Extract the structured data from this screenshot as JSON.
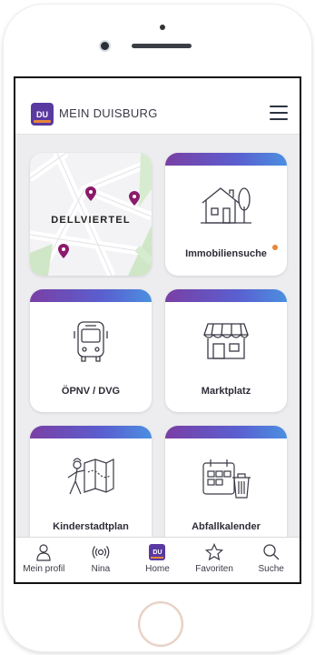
{
  "header": {
    "logo_text": "DU",
    "title": "MEIN DUISBURG"
  },
  "tiles": {
    "map": {
      "label": "DELLVIERTEL"
    },
    "immobilien": {
      "label": "Immobiliensuche"
    },
    "oepnv": {
      "label": "ÖPNV / DVG"
    },
    "marktplatz": {
      "label": "Marktplatz"
    },
    "kinderstadtplan": {
      "label": "Kinderstadtplan"
    },
    "abfallkalender": {
      "label": "Abfallkalender"
    }
  },
  "nav": {
    "items": [
      {
        "label": "Mein profil",
        "icon": "person-icon"
      },
      {
        "label": "Nina",
        "icon": "broadcast-icon"
      },
      {
        "label": "Home",
        "icon": "home-logo-icon",
        "logo_text": "DU"
      },
      {
        "label": "Favoriten",
        "icon": "star-icon"
      },
      {
        "label": "Suche",
        "icon": "search-icon"
      }
    ]
  },
  "colors": {
    "brand_purple": "#5a3aa0",
    "accent_orange": "#e7853a",
    "bar_start": "#7a3fa5",
    "bar_end": "#4b8fe0",
    "map_pin": "#8b1a6b"
  }
}
